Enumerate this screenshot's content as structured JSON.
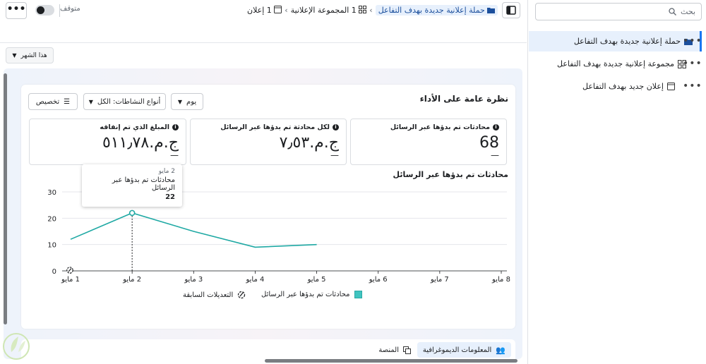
{
  "tree": {
    "search_placeholder": "بحث",
    "items": [
      {
        "label": "حملة إعلانية جديدة بهدف التفاعل",
        "icon": "folder-icon"
      },
      {
        "label": "مجموعة إعلانية جديدة بهدف التفاعل",
        "icon": "grid-icon"
      },
      {
        "label": "إعلان جديد بهدف التفاعل",
        "icon": "ad-icon"
      }
    ],
    "more_label": "•••"
  },
  "topbar": {
    "more_label": "•••",
    "status": "متوقف",
    "breadcrumb": {
      "campaign": "حملة إعلانية جديدة بهدف التفاعل",
      "adset": "1 المجموعة الإعلانية",
      "ad": "1 إعلان"
    },
    "date_filter": "هذا الشهر"
  },
  "overview": {
    "title": "نظرة عامة على الأداء",
    "customize_label": "تخصيص",
    "activity_filter": "أنواع النشاطات: الكل",
    "granularity": "يوم",
    "metrics": [
      {
        "label": "محادثات تم بدؤها عبر الرسائل",
        "value": "68",
        "delta": "—"
      },
      {
        "label": "لكل محادثة تم بدؤها عبر الرسائل",
        "value": "ج.م.‏٧٫٥٣",
        "delta": "—"
      },
      {
        "label": "المبلغ الذي تم إنفاقه",
        "value": "ج.م.‏٥١١٫٧٨",
        "delta": "—"
      }
    ]
  },
  "chart_data": {
    "type": "line",
    "title": "محادثات تم بدؤها عبر الرسائل",
    "categories": [
      "1 مايو",
      "2 مايو",
      "3 مايو",
      "4 مايو",
      "5 مايو",
      "6 مايو",
      "7 مايو",
      "8 مايو"
    ],
    "series": [
      {
        "name": "محادثات تم بدؤها عبر الرسائل",
        "values": [
          12,
          22,
          15,
          9,
          10,
          null,
          null,
          null
        ],
        "color": "#1fa9a4"
      }
    ],
    "yticks": [
      0,
      10,
      20,
      30
    ],
    "ylim": [
      0,
      30
    ],
    "grid": true,
    "legend": [
      "محادثات تم بدؤها عبر الرسائل",
      "التعديلات السابقة"
    ],
    "legend_position": "bottom",
    "tooltip": {
      "date": "2 مايو",
      "label": "محادثات تم بدؤها عبر الرسائل",
      "value": "22"
    },
    "annotation_icon": "edit-history-icon"
  },
  "tabs": [
    {
      "label": "المعلومات الديموغرافية",
      "icon": "people-icon",
      "selected": true
    },
    {
      "label": "المنصة",
      "icon": "platform-icon",
      "selected": false
    }
  ],
  "colors": {
    "accent": "#1877f2",
    "line": "#1fa9a4"
  }
}
